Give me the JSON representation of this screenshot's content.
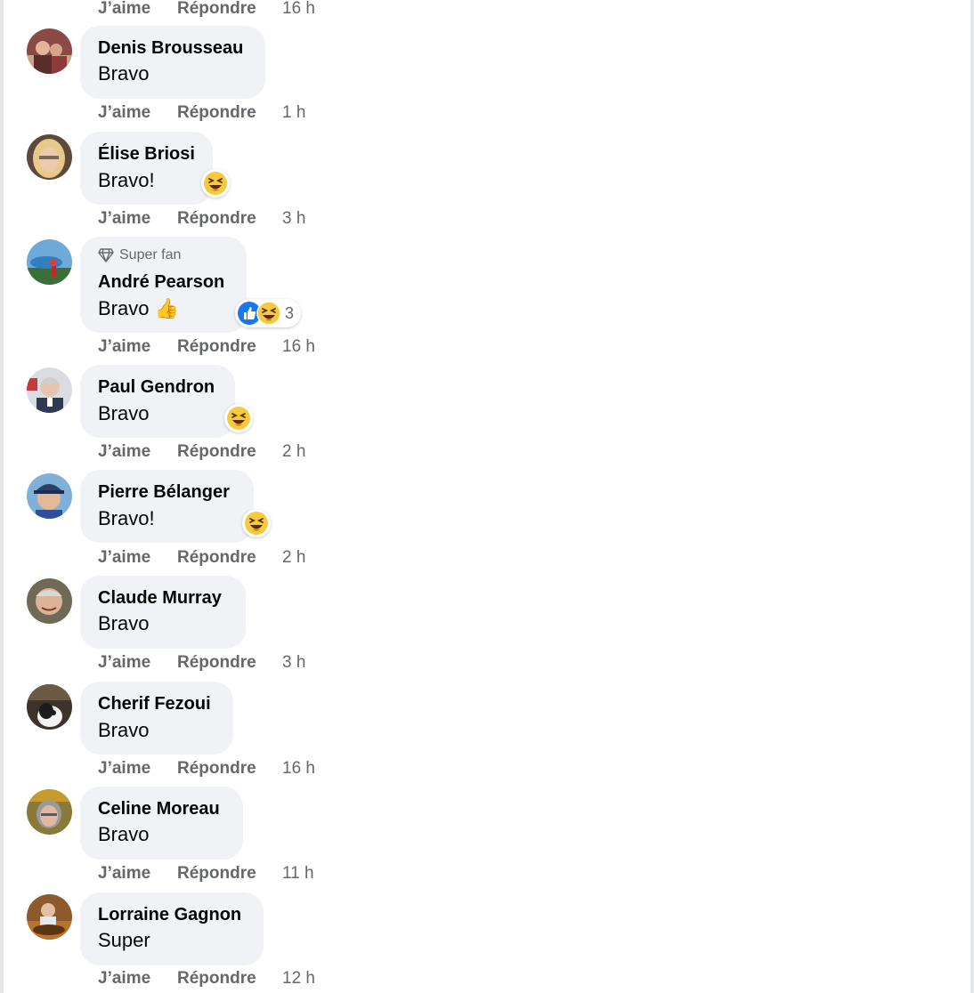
{
  "actions": {
    "like": "J’aime",
    "reply": "Répondre"
  },
  "top_times": [
    "16 h"
  ],
  "badge": {
    "label": "Super fan",
    "icon": "diamond-icon"
  },
  "comments": [
    {
      "name": "Denis Brousseau",
      "text": "Bravo",
      "time": "1 h"
    },
    {
      "name": "Élise Briosi",
      "text": "Bravo!",
      "time": "3 h",
      "reaction": "haha"
    },
    {
      "name": "André Pearson",
      "text": "Bravo 👍",
      "time": "16 h",
      "badge": "Super fan",
      "reaction": "like+haha",
      "reaction_count": "3"
    },
    {
      "name": "Paul Gendron",
      "text": "Bravo",
      "time": "2 h",
      "reaction": "haha"
    },
    {
      "name": "Pierre Bélanger",
      "text": "Bravo!",
      "time": "2 h",
      "reaction": "haha"
    },
    {
      "name": "Claude Murray",
      "text": "Bravo",
      "time": "3 h"
    },
    {
      "name": "Cherif Fezoui",
      "text": "Bravo",
      "time": "16 h"
    },
    {
      "name": "Celine Moreau",
      "text": "Bravo",
      "time": "11 h"
    },
    {
      "name": "Lorraine Gagnon",
      "text": "Super",
      "time": "12 h"
    }
  ],
  "colors": {
    "bubble": "#f0f2f5",
    "meta_text": "#65676b",
    "like_blue": "#1877f2",
    "haha_yellow": "#f7c93c"
  }
}
